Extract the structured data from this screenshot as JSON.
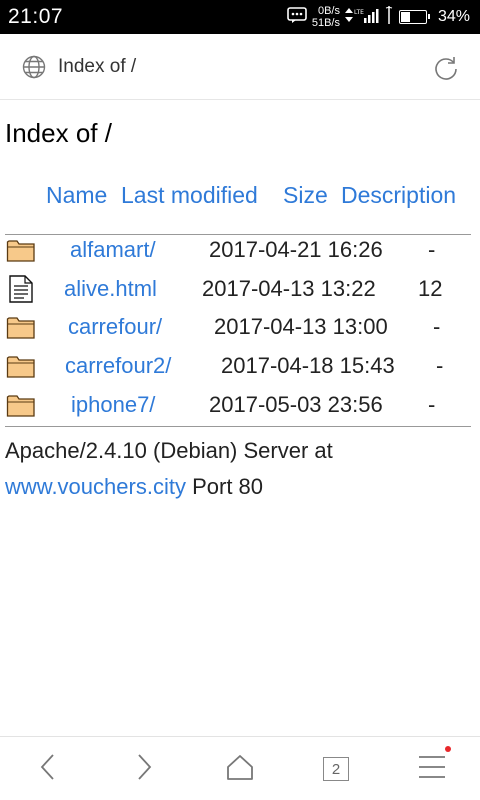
{
  "status_bar": {
    "time": "21:07",
    "speed_up": "0B/s",
    "speed_down": "51B/s",
    "network": "LTE",
    "battery_percent": "34%",
    "battery_level": 0.34
  },
  "address_bar": {
    "title": "Index of /"
  },
  "page": {
    "heading": "Index of /",
    "columns": {
      "name": "Name",
      "last_modified": "Last modified",
      "size": "Size",
      "description": "Description"
    },
    "rows": [
      {
        "icon": "folder-icon",
        "name": "alfamart/",
        "modified": "2017-04-21 16:26",
        "size": "-"
      },
      {
        "icon": "document-icon",
        "name": "alive.html",
        "modified": "2017-04-13 13:22",
        "size": "12"
      },
      {
        "icon": "folder-icon",
        "name": "carrefour/",
        "modified": "2017-04-13 13:00",
        "size": "-"
      },
      {
        "icon": "folder-icon",
        "name": "carrefour2/",
        "modified": "2017-04-18 15:43",
        "size": "-"
      },
      {
        "icon": "folder-icon",
        "name": "iphone7/",
        "modified": "2017-05-03 23:56",
        "size": "-"
      }
    ],
    "footer": {
      "server": "Apache/2.4.10 (Debian) Server at",
      "host": "www.vouchers.city",
      "port": "Port 80"
    }
  },
  "bottom_nav": {
    "tab_count": "2"
  },
  "colors": {
    "link": "#2f7ad8",
    "status_bar_bg": "#000000",
    "notification_dot": "#e8272b"
  }
}
